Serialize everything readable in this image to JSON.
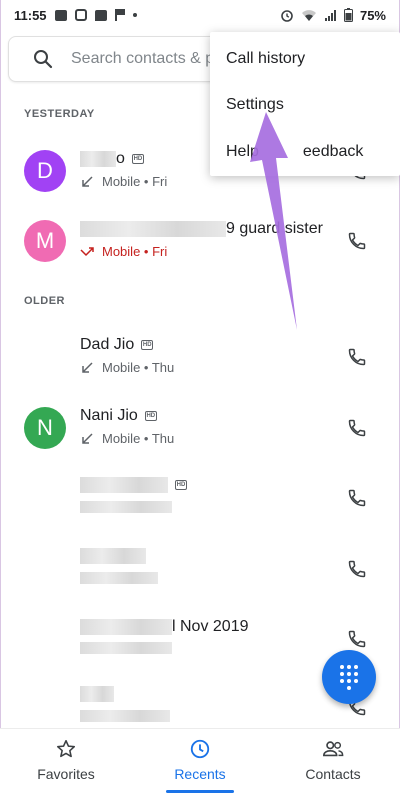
{
  "status_bar": {
    "time": "11:55",
    "battery": "75%"
  },
  "search": {
    "placeholder": "Search contacts & p"
  },
  "sections": {
    "yesterday": "YESTERDAY",
    "older": "OLDER"
  },
  "menu": {
    "items": [
      "Call history",
      "Settings",
      "Help & feedback"
    ],
    "help_visible_left": "Help",
    "help_visible_right": "eedback"
  },
  "calls": [
    {
      "initial": "D",
      "name_suffix": "o",
      "sub": "Mobile • Fri",
      "missed": false,
      "avatar_color": "#a142f4"
    },
    {
      "initial": "M",
      "name_suffix": "9 guard sister",
      "sub": "Mobile • Fri",
      "missed": true,
      "avatar_color": "#f06bb3"
    },
    {
      "name": "Dad Jio",
      "sub": "Mobile • Thu",
      "missed": false
    },
    {
      "initial": "N",
      "name": "Nani Jio",
      "sub": "Mobile • Thu",
      "missed": false,
      "avatar_color": "#34a853"
    },
    {
      "sub": "",
      "missed": false
    },
    {
      "sub": "",
      "missed": false
    },
    {
      "name_suffix": "l Nov 2019",
      "sub": "",
      "missed": false
    },
    {
      "sub": "",
      "missed": false
    }
  ],
  "nav": {
    "favorites": "Favorites",
    "recents": "Recents",
    "contacts": "Contacts"
  },
  "colors": {
    "accent": "#1a73e8",
    "missed": "#c5221f",
    "arrow": "#a66ee0"
  }
}
